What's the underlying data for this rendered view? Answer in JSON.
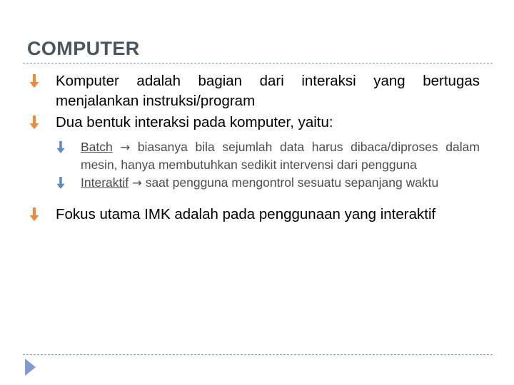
{
  "slide": {
    "title": "COMPUTER",
    "title_color": "#4a5560",
    "rule_color": "#7f93ad",
    "bullet_level1_color": "#ed8b3c",
    "bullet_level2_color": "#5f8ac4",
    "footer_marker_color": "#7f9bd0",
    "body_text_color": "#000000",
    "sub_text_color": "#4d4d4d",
    "background_color": "#ffffff"
  },
  "bullets": [
    {
      "level": 1,
      "marker": "down-arrow-icon",
      "text": "Komputer adalah bagian dari interaksi yang bertugas menjalankan instruksi/program"
    },
    {
      "level": 1,
      "marker": "down-arrow-icon",
      "text": "Dua bentuk interaksi pada komputer, yaitu:"
    }
  ],
  "sub_bullets": [
    {
      "level": 2,
      "marker": "down-arrow-icon",
      "term": "Batch",
      "arrow": "→",
      "text": "biasanya bila sejumlah data harus dibaca/diproses dalam mesin, hanya membutuhkan sedikit intervensi dari pengguna"
    },
    {
      "level": 2,
      "marker": "down-arrow-icon",
      "term": "Interaktif",
      "arrow": "→",
      "text": "saat pengguna mengontrol sesuatu sepanjang waktu"
    }
  ],
  "closing_bullet": {
    "level": 1,
    "marker": "down-arrow-icon",
    "text": "Fokus utama IMK adalah pada penggunaan yang interaktif"
  }
}
